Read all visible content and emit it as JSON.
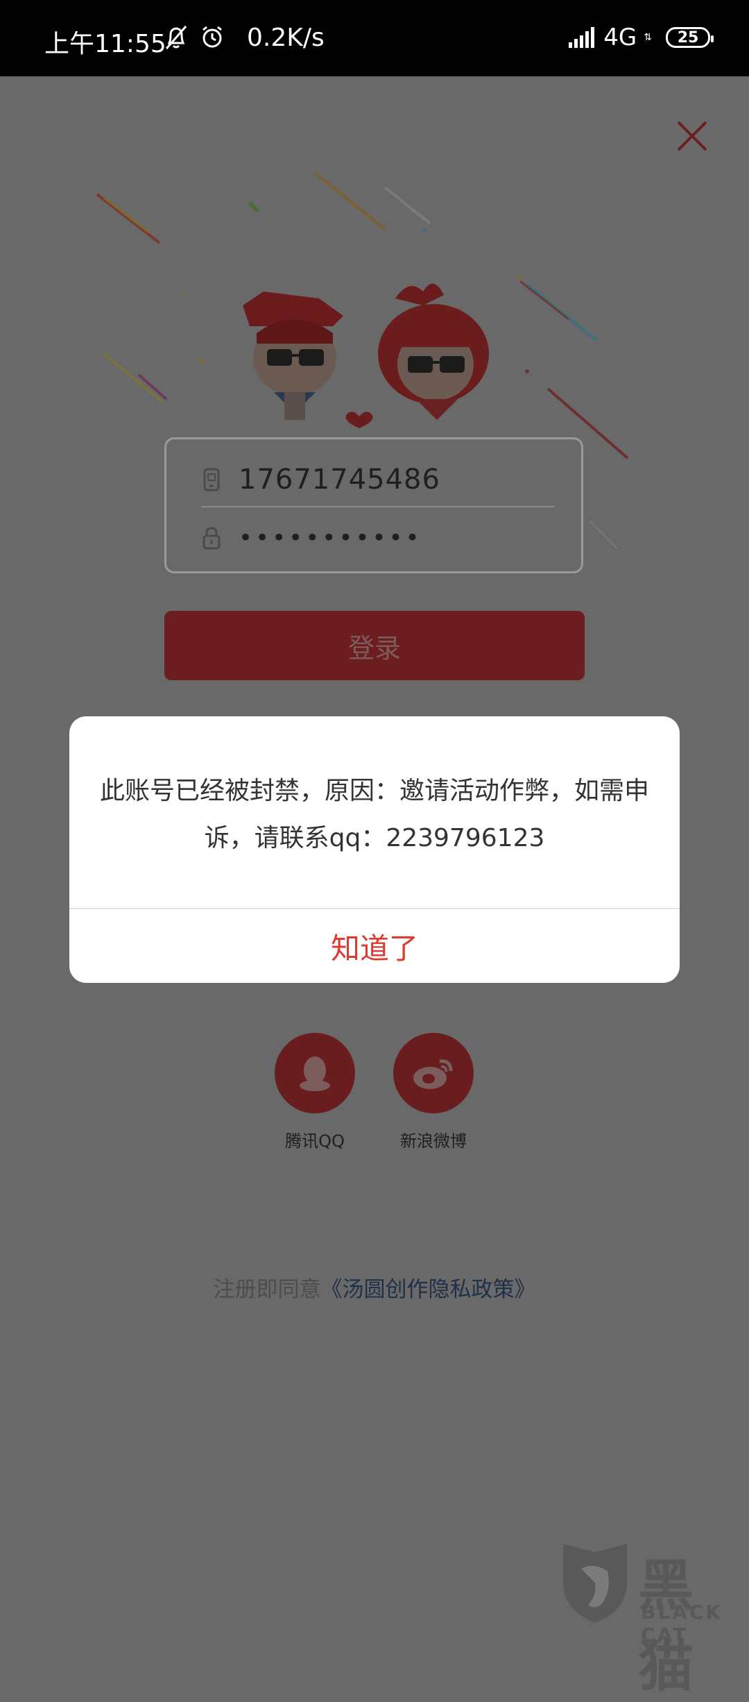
{
  "status_bar": {
    "time": "上午11:55",
    "net_speed": "0.2K/s",
    "network": "4G",
    "battery": "25"
  },
  "login": {
    "phone": "17671745486",
    "password_masked": "•••••••••••",
    "login_label": "登录"
  },
  "social": [
    {
      "label": "腾讯QQ",
      "icon": "qq-icon"
    },
    {
      "label": "新浪微博",
      "icon": "weibo-icon"
    }
  ],
  "policy": {
    "prefix": "注册即同意",
    "link": "《汤圆创作隐私政策》"
  },
  "dialog": {
    "message": "此账号已经被封禁，原因：邀请活动作弊，如需申诉，请联系qq：2239796123",
    "confirm_label": "知道了"
  },
  "watermark": {
    "text": "黑猫",
    "sub": "BLACK CAT"
  },
  "colors": {
    "accent": "#e0392f",
    "login_button": "#6b1d1f",
    "overlay": "#696969"
  }
}
